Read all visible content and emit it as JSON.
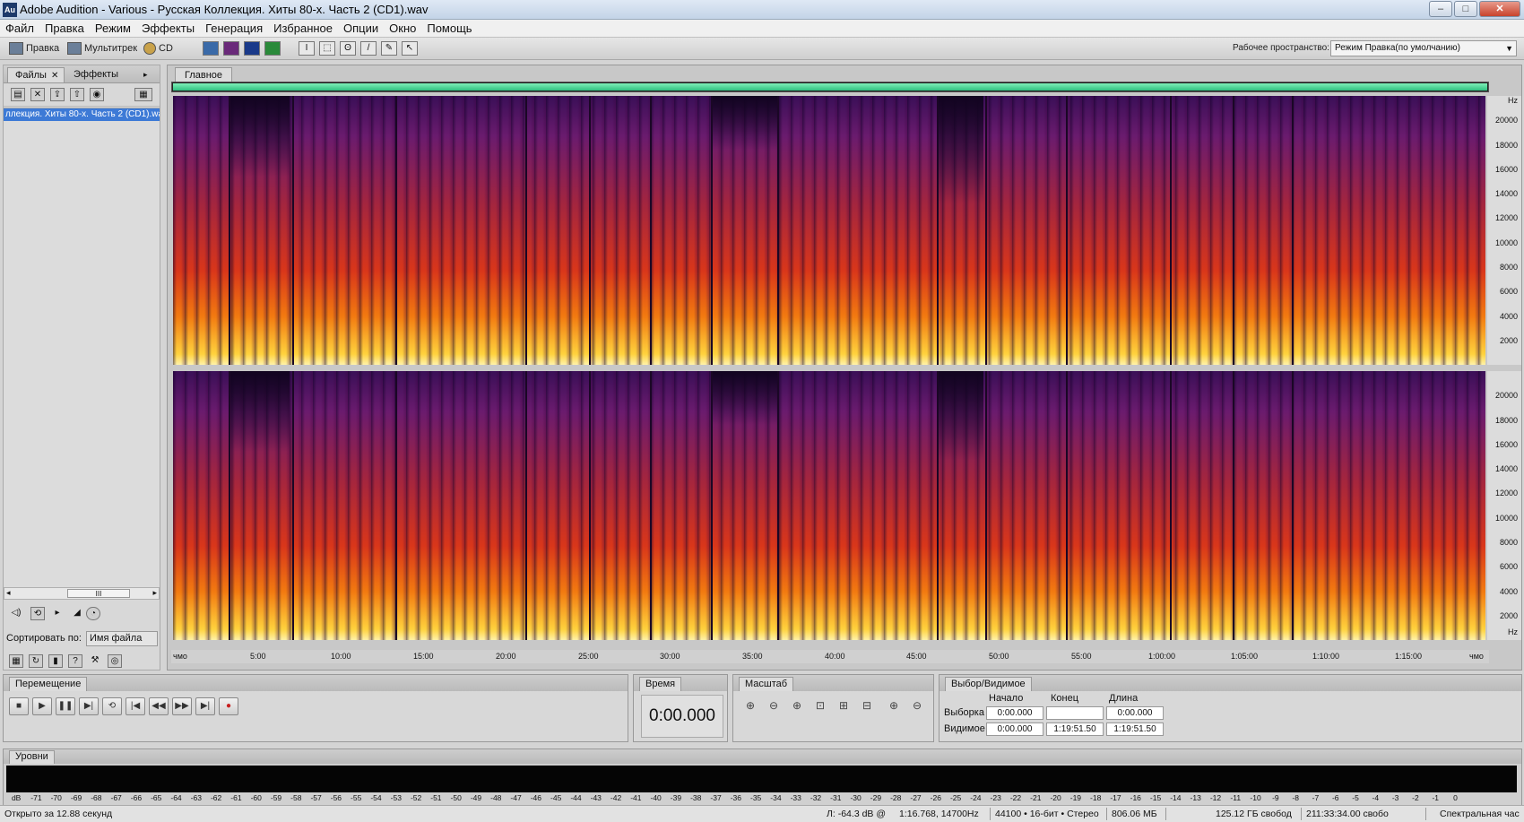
{
  "window": {
    "app_icon": "Au",
    "title": "Adobe Audition - Various - Русская Коллекция. Хиты 80-х. Часть 2 (CD1).wav",
    "min": "–",
    "max": "□",
    "close": "✕"
  },
  "menu": [
    "Файл",
    "Правка",
    "Режим",
    "Эффекты",
    "Генерация",
    "Избранное",
    "Опции",
    "Окно",
    "Помощь"
  ],
  "toolbar": {
    "mode_edit": "Правка",
    "mode_multitrack": "Мультитрек",
    "mode_cd": "CD",
    "workspace_label": "Рабочее пространство:",
    "workspace_value": "Режим Правка(по умолчанию)"
  },
  "files_panel": {
    "tab_files": "Файлы",
    "tab_effects": "Эффекты",
    "selected_file": "ллекция. Хиты 80-х. Часть 2 (CD1).wav",
    "scroll_thumb": "III",
    "sort_label": "Сортировать по:",
    "sort_value": "Имя файла"
  },
  "editor": {
    "tab": "Главное",
    "freq_unit": "Hz",
    "freq_labels": [
      "20000",
      "18000",
      "16000",
      "14000",
      "12000",
      "10000",
      "8000",
      "6000",
      "4000",
      "2000"
    ],
    "time_labels": [
      "чмо",
      "5:00",
      "10:00",
      "15:00",
      "20:00",
      "25:00",
      "30:00",
      "35:00",
      "40:00",
      "45:00",
      "50:00",
      "55:00",
      "1:00:00",
      "1:05:00",
      "1:10:00",
      "1:15:00",
      "чмо"
    ]
  },
  "transport": {
    "tab": "Перемещение",
    "buttons": [
      "■",
      "▶",
      "❚❚",
      "▶|",
      "⟲",
      "|◀",
      "◀◀",
      "▶▶",
      "▶|",
      "●"
    ]
  },
  "time_panel": {
    "tab": "Время",
    "value": "0:00.000"
  },
  "zoom_panel": {
    "tab": "Масштаб"
  },
  "selection_panel": {
    "tab": "Выбор/Видимое",
    "col_start": "Начало",
    "col_end": "Конец",
    "col_length": "Длина",
    "row_selection": "Выборка",
    "row_visible": "Видимое",
    "sel_start": "0:00.000",
    "sel_end": "",
    "sel_length": "0:00.000",
    "vis_start": "0:00.000",
    "vis_end": "1:19:51.50",
    "vis_length": "1:19:51.50"
  },
  "levels_panel": {
    "tab": "Уровни",
    "scale": [
      "dB",
      "-71",
      "-70",
      "-69",
      "-68",
      "-67",
      "-66",
      "-65",
      "-64",
      "-63",
      "-62",
      "-61",
      "-60",
      "-59",
      "-58",
      "-57",
      "-56",
      "-55",
      "-54",
      "-53",
      "-52",
      "-51",
      "-50",
      "-49",
      "-48",
      "-47",
      "-46",
      "-45",
      "-44",
      "-43",
      "-42",
      "-41",
      "-40",
      "-39",
      "-38",
      "-37",
      "-36",
      "-35",
      "-34",
      "-33",
      "-32",
      "-31",
      "-30",
      "-29",
      "-28",
      "-27",
      "-26",
      "-25",
      "-24",
      "-23",
      "-22",
      "-21",
      "-20",
      "-19",
      "-18",
      "-17",
      "-16",
      "-15",
      "-14",
      "-13",
      "-12",
      "-11",
      "-10",
      "-9",
      "-8",
      "-7",
      "-6",
      "-5",
      "-4",
      "-3",
      "-2",
      "-1",
      "0"
    ]
  },
  "status": {
    "opened": "Открыто за 12.88 секунд",
    "cursor": "Л: -64.3 dB @",
    "position": "1:16.768, 14700Hz",
    "format": "44100 • 16-бит • Стерео",
    "size": "806.06 МБ",
    "free_space": "125.12 ГБ свобод",
    "free_time": "211:33:34.00 свобо",
    "view": "Спектральная час"
  },
  "colors": {
    "accent_green": "#30c080",
    "selection_blue": "#3d7ad6"
  }
}
